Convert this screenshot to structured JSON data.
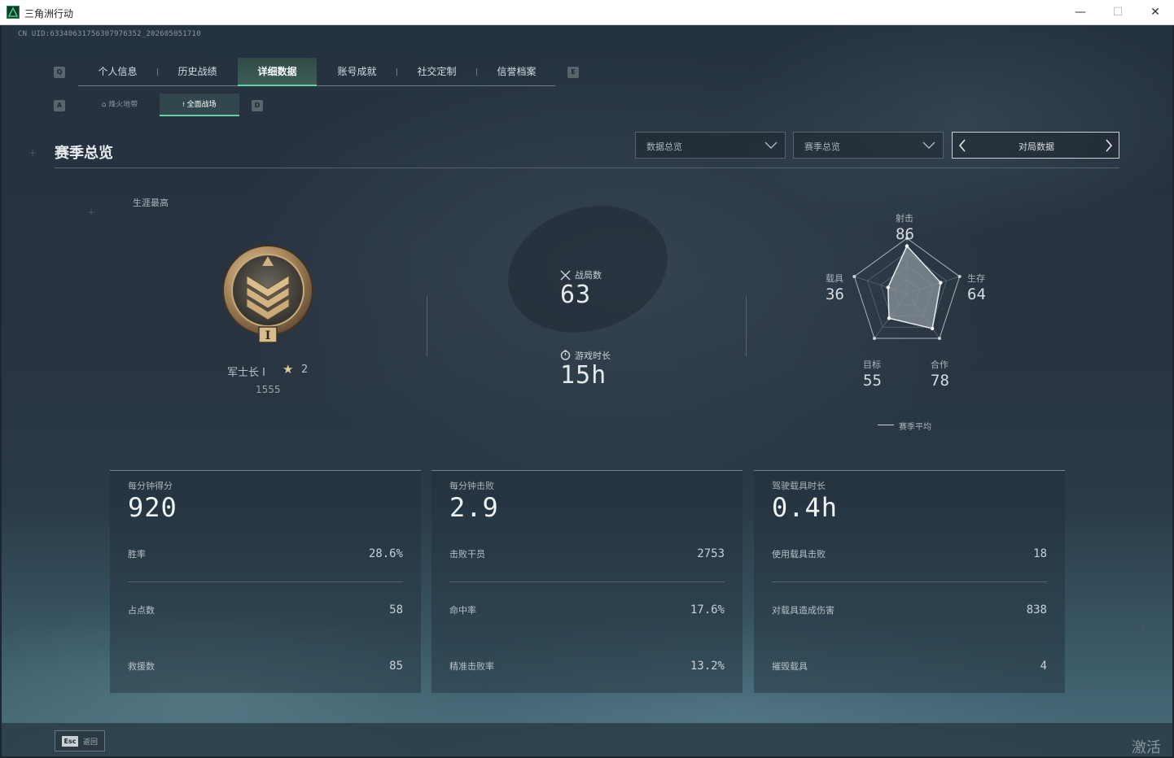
{
  "window": {
    "title": "三角洲行动",
    "minimize_glyph": "—",
    "maximize_glyph": "☐",
    "close_glyph": "✕"
  },
  "uid_text": "CN UID:6334063175630797635​2_202605051710",
  "nav": {
    "left_key": "Q",
    "right_key": "E",
    "tabs": [
      "个人信息",
      "历史战绩",
      "详细数据",
      "账号成就",
      "社交定制",
      "信誉档案"
    ],
    "active_index": 2
  },
  "subnav": {
    "left_key": "A",
    "right_key": "D",
    "tabs": [
      "烽火地带",
      "全面战场"
    ],
    "active_index": 1
  },
  "section": {
    "title": "赛季总览",
    "dropdown1": "数据总览",
    "dropdown2": "赛季总览",
    "pager_label": "对局数据"
  },
  "rank": {
    "career_label": "生涯最高",
    "name": "军士长 I",
    "numeral": "I",
    "star_icon": "star-icon",
    "stars": "2",
    "score": "1555"
  },
  "summary": {
    "matches_label": "战局数",
    "matches_value": "63",
    "playtime_label": "游戏时长",
    "playtime_value": "15h"
  },
  "radar": {
    "axes": [
      {
        "label": "射击",
        "value": "86"
      },
      {
        "label": "生存",
        "value": "64"
      },
      {
        "label": "合作",
        "value": "78"
      },
      {
        "label": "目标",
        "value": "55"
      },
      {
        "label": "载具",
        "value": "36"
      }
    ],
    "values": [
      86,
      64,
      78,
      55,
      36
    ],
    "legend": "赛季平均",
    "max": 100
  },
  "cards": [
    {
      "title": "每分钟得分",
      "value": "920",
      "rows": [
        {
          "label": "胜率",
          "value": "28.6%"
        },
        {
          "label": "占点数",
          "value": "58"
        },
        {
          "label": "救援数",
          "value": "85"
        }
      ]
    },
    {
      "title": "每分钟击败",
      "value": "2.9",
      "rows": [
        {
          "label": "击败干员",
          "value": "2753"
        },
        {
          "label": "命中率",
          "value": "17.6%"
        },
        {
          "label": "精准击败率",
          "value": "13.2%"
        }
      ]
    },
    {
      "title": "驾驶载具时长",
      "value": "0.4h",
      "rows": [
        {
          "label": "使用载具击败",
          "value": "18"
        },
        {
          "label": "对载具造成伤害",
          "value": "838"
        },
        {
          "label": "摧毁载具",
          "value": "4"
        }
      ]
    }
  ],
  "footer": {
    "esc_key": "Esc",
    "esc_label": "返回",
    "watermark": "激活"
  },
  "colors": {
    "accent": "#5fd3a1",
    "background": "#253240",
    "radar_fill": "#8a949b"
  }
}
